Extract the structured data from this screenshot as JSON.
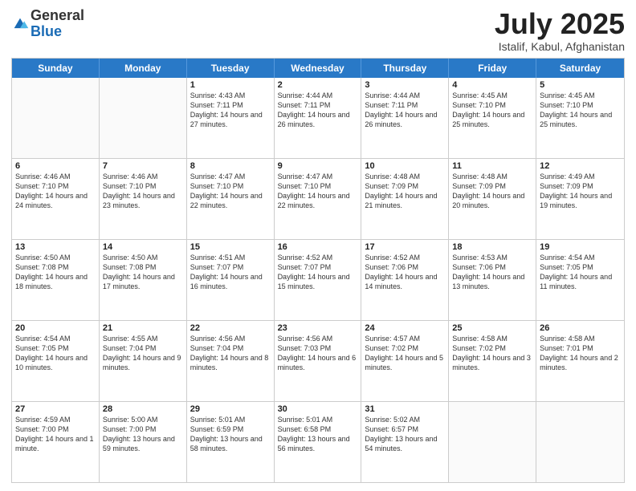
{
  "logo": {
    "general": "General",
    "blue": "Blue"
  },
  "title": {
    "month": "July 2025",
    "location": "Istalif, Kabul, Afghanistan"
  },
  "header_days": [
    "Sunday",
    "Monday",
    "Tuesday",
    "Wednesday",
    "Thursday",
    "Friday",
    "Saturday"
  ],
  "weeks": [
    [
      {
        "day": "",
        "empty": true
      },
      {
        "day": "",
        "empty": true
      },
      {
        "day": "1",
        "sunrise": "4:43 AM",
        "sunset": "7:11 PM",
        "daylight": "14 hours and 27 minutes."
      },
      {
        "day": "2",
        "sunrise": "4:44 AM",
        "sunset": "7:11 PM",
        "daylight": "14 hours and 26 minutes."
      },
      {
        "day": "3",
        "sunrise": "4:44 AM",
        "sunset": "7:11 PM",
        "daylight": "14 hours and 26 minutes."
      },
      {
        "day": "4",
        "sunrise": "4:45 AM",
        "sunset": "7:10 PM",
        "daylight": "14 hours and 25 minutes."
      },
      {
        "day": "5",
        "sunrise": "4:45 AM",
        "sunset": "7:10 PM",
        "daylight": "14 hours and 25 minutes."
      }
    ],
    [
      {
        "day": "6",
        "sunrise": "4:46 AM",
        "sunset": "7:10 PM",
        "daylight": "14 hours and 24 minutes."
      },
      {
        "day": "7",
        "sunrise": "4:46 AM",
        "sunset": "7:10 PM",
        "daylight": "14 hours and 23 minutes."
      },
      {
        "day": "8",
        "sunrise": "4:47 AM",
        "sunset": "7:10 PM",
        "daylight": "14 hours and 22 minutes."
      },
      {
        "day": "9",
        "sunrise": "4:47 AM",
        "sunset": "7:10 PM",
        "daylight": "14 hours and 22 minutes."
      },
      {
        "day": "10",
        "sunrise": "4:48 AM",
        "sunset": "7:09 PM",
        "daylight": "14 hours and 21 minutes."
      },
      {
        "day": "11",
        "sunrise": "4:48 AM",
        "sunset": "7:09 PM",
        "daylight": "14 hours and 20 minutes."
      },
      {
        "day": "12",
        "sunrise": "4:49 AM",
        "sunset": "7:09 PM",
        "daylight": "14 hours and 19 minutes."
      }
    ],
    [
      {
        "day": "13",
        "sunrise": "4:50 AM",
        "sunset": "7:08 PM",
        "daylight": "14 hours and 18 minutes."
      },
      {
        "day": "14",
        "sunrise": "4:50 AM",
        "sunset": "7:08 PM",
        "daylight": "14 hours and 17 minutes."
      },
      {
        "day": "15",
        "sunrise": "4:51 AM",
        "sunset": "7:07 PM",
        "daylight": "14 hours and 16 minutes."
      },
      {
        "day": "16",
        "sunrise": "4:52 AM",
        "sunset": "7:07 PM",
        "daylight": "14 hours and 15 minutes."
      },
      {
        "day": "17",
        "sunrise": "4:52 AM",
        "sunset": "7:06 PM",
        "daylight": "14 hours and 14 minutes."
      },
      {
        "day": "18",
        "sunrise": "4:53 AM",
        "sunset": "7:06 PM",
        "daylight": "14 hours and 13 minutes."
      },
      {
        "day": "19",
        "sunrise": "4:54 AM",
        "sunset": "7:05 PM",
        "daylight": "14 hours and 11 minutes."
      }
    ],
    [
      {
        "day": "20",
        "sunrise": "4:54 AM",
        "sunset": "7:05 PM",
        "daylight": "14 hours and 10 minutes."
      },
      {
        "day": "21",
        "sunrise": "4:55 AM",
        "sunset": "7:04 PM",
        "daylight": "14 hours and 9 minutes."
      },
      {
        "day": "22",
        "sunrise": "4:56 AM",
        "sunset": "7:04 PM",
        "daylight": "14 hours and 8 minutes."
      },
      {
        "day": "23",
        "sunrise": "4:56 AM",
        "sunset": "7:03 PM",
        "daylight": "14 hours and 6 minutes."
      },
      {
        "day": "24",
        "sunrise": "4:57 AM",
        "sunset": "7:02 PM",
        "daylight": "14 hours and 5 minutes."
      },
      {
        "day": "25",
        "sunrise": "4:58 AM",
        "sunset": "7:02 PM",
        "daylight": "14 hours and 3 minutes."
      },
      {
        "day": "26",
        "sunrise": "4:58 AM",
        "sunset": "7:01 PM",
        "daylight": "14 hours and 2 minutes."
      }
    ],
    [
      {
        "day": "27",
        "sunrise": "4:59 AM",
        "sunset": "7:00 PM",
        "daylight": "14 hours and 1 minute."
      },
      {
        "day": "28",
        "sunrise": "5:00 AM",
        "sunset": "7:00 PM",
        "daylight": "13 hours and 59 minutes."
      },
      {
        "day": "29",
        "sunrise": "5:01 AM",
        "sunset": "6:59 PM",
        "daylight": "13 hours and 58 minutes."
      },
      {
        "day": "30",
        "sunrise": "5:01 AM",
        "sunset": "6:58 PM",
        "daylight": "13 hours and 56 minutes."
      },
      {
        "day": "31",
        "sunrise": "5:02 AM",
        "sunset": "6:57 PM",
        "daylight": "13 hours and 54 minutes."
      },
      {
        "day": "",
        "empty": true
      },
      {
        "day": "",
        "empty": true
      }
    ]
  ]
}
